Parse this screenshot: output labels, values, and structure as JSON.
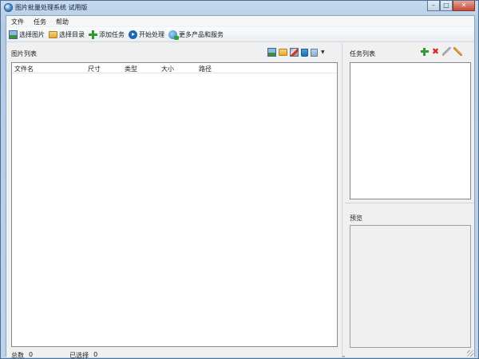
{
  "window": {
    "title": "图片批量处理系统 试用版",
    "minimize_glyph": "–",
    "maximize_glyph": "□",
    "close_glyph": "✕"
  },
  "menu": {
    "items": [
      {
        "label": "文件"
      },
      {
        "label": "任务"
      },
      {
        "label": "帮助"
      }
    ]
  },
  "toolbar": {
    "buttons": [
      {
        "label": "选择图片",
        "icon": "image-icon"
      },
      {
        "label": "选择目录",
        "icon": "folder-icon"
      },
      {
        "label": "添加任务",
        "icon": "plus-icon"
      },
      {
        "label": "开始处理",
        "icon": "play-icon"
      },
      {
        "label": "更多产品和服务",
        "icon": "globe-icon"
      }
    ]
  },
  "image_list": {
    "title": "图片列表",
    "columns": [
      "文件名",
      "尺寸",
      "类型",
      "大小",
      "路径"
    ],
    "rows": []
  },
  "status": {
    "total_label": "总数",
    "total_value": "0",
    "selected_label": "已选择",
    "selected_value": "0"
  },
  "task_list": {
    "title": "任务列表",
    "items": []
  },
  "preview": {
    "title": "预览"
  },
  "colors": {
    "title_bar": "#b3cbe4",
    "client_bg": "#f0f0f0",
    "list_bg": "#ffffff",
    "close_button": "#c44a37"
  }
}
